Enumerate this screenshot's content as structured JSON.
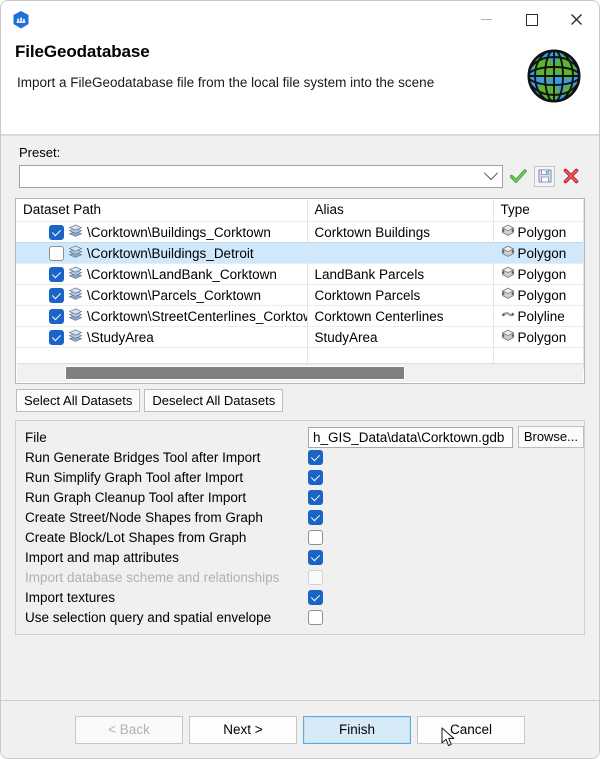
{
  "window": {
    "app_icon": "esri-cityengine-icon",
    "controls": {
      "minimize": "minimize-icon",
      "maximize": "maximize-icon",
      "close": "close-icon"
    }
  },
  "header": {
    "title": "FileGeodatabase",
    "subtitle": "Import a FileGeodatabase file from the local file system into the scene",
    "logo": "arcgis-globe-logo"
  },
  "preset": {
    "label": "Preset:",
    "value": "",
    "placeholder": "",
    "apply_icon": "green-check-icon",
    "save_icon": "floppy-disk-save-icon",
    "delete_icon": "red-x-delete-icon"
  },
  "table": {
    "columns": [
      "Dataset Path",
      "Alias",
      "Type"
    ],
    "rows": [
      {
        "checked": true,
        "selected": false,
        "layer_icon": "layer-stack-icon",
        "path": "\\Corktown\\Buildings_Corktown",
        "alias": "Corktown Buildings",
        "type": "Polygon",
        "type_icon": "polygon-geometry-icon"
      },
      {
        "checked": false,
        "selected": true,
        "layer_icon": "layer-stack-icon",
        "path": "\\Corktown\\Buildings_Detroit",
        "alias": "",
        "type": "Polygon",
        "type_icon": "polygon-geometry-icon"
      },
      {
        "checked": true,
        "selected": false,
        "layer_icon": "layer-stack-icon",
        "path": "\\Corktown\\LandBank_Corktown",
        "alias": "LandBank Parcels",
        "type": "Polygon",
        "type_icon": "polygon-geometry-icon"
      },
      {
        "checked": true,
        "selected": false,
        "layer_icon": "layer-stack-icon",
        "path": "\\Corktown\\Parcels_Corktown",
        "alias": "Corktown Parcels",
        "type": "Polygon",
        "type_icon": "polygon-geometry-icon"
      },
      {
        "checked": true,
        "selected": false,
        "layer_icon": "layer-stack-icon",
        "path": "\\Corktown\\StreetCenterlines_Corktown",
        "alias": "Corktown Centerlines",
        "type": "Polyline",
        "type_icon": "polyline-geometry-icon"
      },
      {
        "checked": true,
        "selected": false,
        "layer_icon": "layer-stack-icon",
        "path": "\\StudyArea",
        "alias": "StudyArea",
        "type": "Polygon",
        "type_icon": "polygon-geometry-icon"
      }
    ],
    "scrollbar": "horizontal-scrollbar"
  },
  "dataset_buttons": {
    "select_all": "Select All Datasets",
    "deselect_all": "Deselect All Datasets"
  },
  "options": {
    "file": {
      "label": "File",
      "value": "h_GIS_Data\\data\\Corktown.gdb",
      "browse_label": "Browse..."
    },
    "checkboxes": [
      {
        "label": "Run Generate Bridges Tool after Import",
        "checked": true,
        "enabled": true
      },
      {
        "label": "Run Simplify Graph Tool after Import",
        "checked": true,
        "enabled": true
      },
      {
        "label": "Run Graph Cleanup Tool after Import",
        "checked": true,
        "enabled": true
      },
      {
        "label": "Create Street/Node Shapes from Graph",
        "checked": true,
        "enabled": true
      },
      {
        "label": "Create Block/Lot Shapes from Graph",
        "checked": false,
        "enabled": true
      },
      {
        "label": "Import and map attributes",
        "checked": true,
        "enabled": true
      },
      {
        "label": "Import database scheme and relationships",
        "checked": false,
        "enabled": false
      },
      {
        "label": "Import textures",
        "checked": true,
        "enabled": true
      },
      {
        "label": "Use selection query and spatial envelope",
        "checked": false,
        "enabled": true
      }
    ]
  },
  "footer": {
    "back": "< Back",
    "next": "Next >",
    "finish": "Finish",
    "cancel": "Cancel"
  },
  "colors": {
    "accent_checkbox": "#1a64c8",
    "selection_row": "#cfe8fb",
    "primary_button": "#d6eaf8",
    "panel_background": "#f0f0f0"
  }
}
